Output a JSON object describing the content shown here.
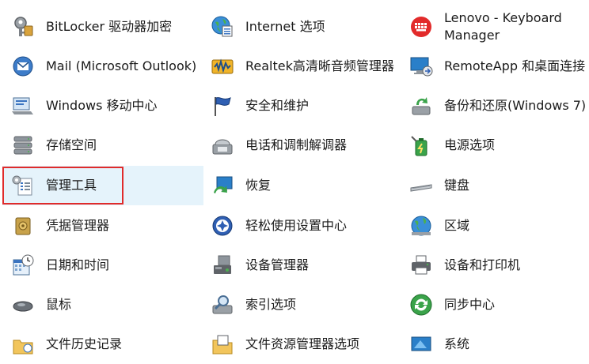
{
  "columns": [
    {
      "items": [
        {
          "label": "BitLocker 驱动器加密",
          "icon": "bitlocker-key-icon"
        },
        {
          "label": "Mail (Microsoft Outlook)",
          "icon": "mail-icon"
        },
        {
          "label": "Windows 移动中心",
          "icon": "mobility-center-icon"
        },
        {
          "label": "存储空间",
          "icon": "storage-spaces-icon"
        },
        {
          "label": "管理工具",
          "icon": "admin-tools-icon",
          "selected": true
        },
        {
          "label": "凭据管理器",
          "icon": "credential-manager-icon"
        },
        {
          "label": "日期和时间",
          "icon": "date-time-icon"
        },
        {
          "label": "鼠标",
          "icon": "mouse-icon"
        },
        {
          "label": "文件历史记录",
          "icon": "file-history-icon"
        }
      ]
    },
    {
      "items": [
        {
          "label": "Internet 选项",
          "icon": "internet-options-icon"
        },
        {
          "label": "Realtek高清晰音频管理器",
          "icon": "realtek-audio-icon"
        },
        {
          "label": "安全和维护",
          "icon": "security-flag-icon"
        },
        {
          "label": "电话和调制解调器",
          "icon": "phone-modem-icon"
        },
        {
          "label": "恢复",
          "icon": "recovery-icon"
        },
        {
          "label": "轻松使用设置中心",
          "icon": "ease-of-access-icon"
        },
        {
          "label": "设备管理器",
          "icon": "device-manager-icon"
        },
        {
          "label": "索引选项",
          "icon": "indexing-icon"
        },
        {
          "label": "文件资源管理器选项",
          "icon": "explorer-options-icon"
        }
      ]
    },
    {
      "items": [
        {
          "label": "Lenovo - Keyboard Manager",
          "icon": "keyboard-manager-icon"
        },
        {
          "label": "RemoteApp 和桌面连接",
          "icon": "remoteapp-icon"
        },
        {
          "label": "备份和还原(Windows 7)",
          "icon": "backup-restore-icon"
        },
        {
          "label": "电源选项",
          "icon": "power-options-icon"
        },
        {
          "label": "键盘",
          "icon": "keyboard-icon"
        },
        {
          "label": "区域",
          "icon": "region-globe-icon"
        },
        {
          "label": "设备和打印机",
          "icon": "printer-icon"
        },
        {
          "label": "同步中心",
          "icon": "sync-center-icon"
        },
        {
          "label": "系统",
          "icon": "system-icon"
        }
      ]
    }
  ],
  "colors": {
    "highlight_bg": "#e5f3fb",
    "annotation_border": "#e02b2b"
  }
}
